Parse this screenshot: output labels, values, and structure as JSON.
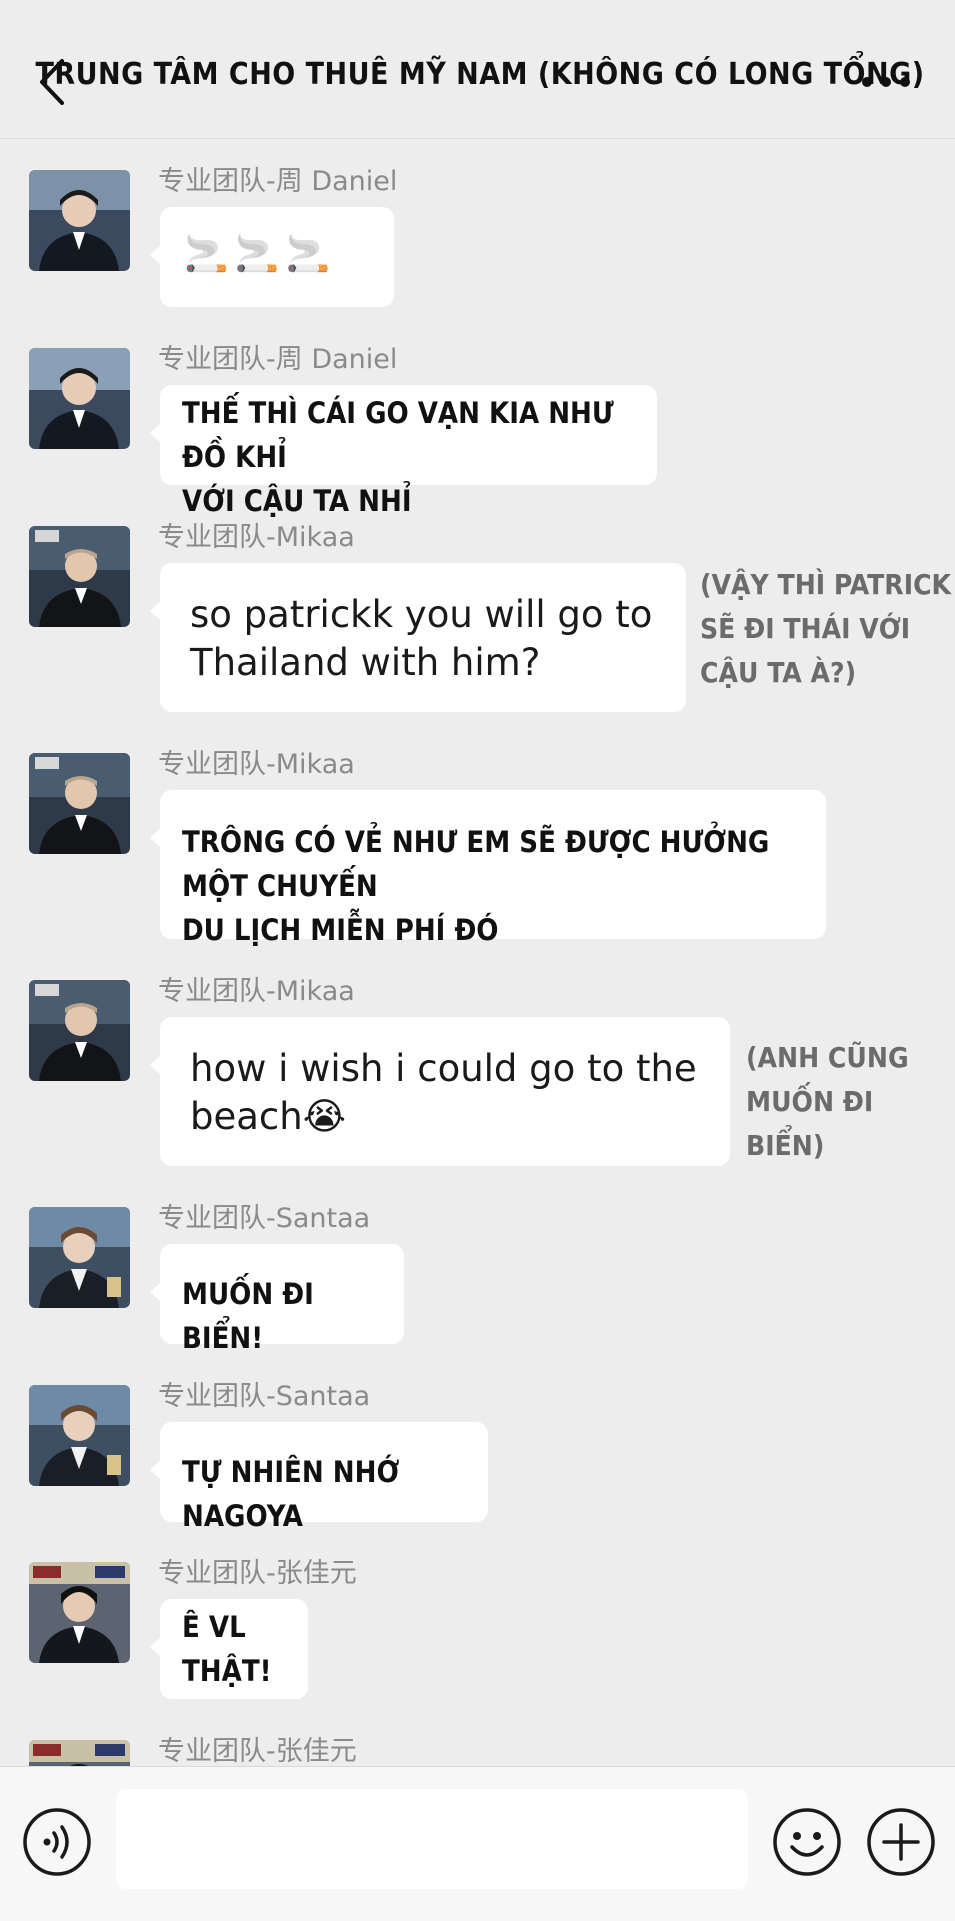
{
  "header": {
    "title": "TRUNG TÂM CHO THUÊ MỸ NAM (KHÔNG CÓ LONG TỔNG)",
    "back_icon": "chevron-left-icon",
    "more_icon": "more-dots-icon"
  },
  "messages": [
    {
      "sender": "专业团队-周 Daniel",
      "text": "🚬🚬🚬"
    },
    {
      "sender": "专业团队-周 Daniel",
      "text": "THẾ THÌ CÁI GO VẠN KIA NHƯ ĐỒ KHỈ\nVỚI CẬU TA NHỈ"
    },
    {
      "sender": "专业团队-Mikaa",
      "text": "so patrickk you will go to\nThailand with him?",
      "note": "(VẬY THÌ PATRICK\nSẼ ĐI THÁI VỚI\nCẬU TA À?)"
    },
    {
      "sender": "专业团队-Mikaa",
      "text": "TRÔNG CÓ VẺ NHƯ EM SẼ ĐƯỢC HƯỞNG MỘT CHUYẾN\nDU LỊCH MIỄN PHÍ ĐÓ"
    },
    {
      "sender": "专业团队-Mikaa",
      "text": "how i wish i could go to the\nbeach😭",
      "note": "(ANH CŨNG\nMUỐN ĐI BIỂN)"
    },
    {
      "sender": "专业团队-Santaa",
      "text": "MUỐN ĐI BIỂN!"
    },
    {
      "sender": "专业团队-Santaa",
      "text": "TỰ NHIÊN NHỚ NAGOYA"
    },
    {
      "sender": "专业团队-张佳元",
      "text": "Ê VL\nTHẬT!"
    },
    {
      "sender": "专业团队-张佳元",
      "text": ""
    }
  ],
  "input": {
    "placeholder": "",
    "voice_icon": "voice-icon",
    "emoji_icon": "emoji-icon",
    "plus_icon": "plus-icon"
  },
  "colors": {
    "background": "#ededed",
    "bubble": "#ffffff",
    "sender_text": "#8a8a8a",
    "note_text": "#6b6b6b"
  }
}
